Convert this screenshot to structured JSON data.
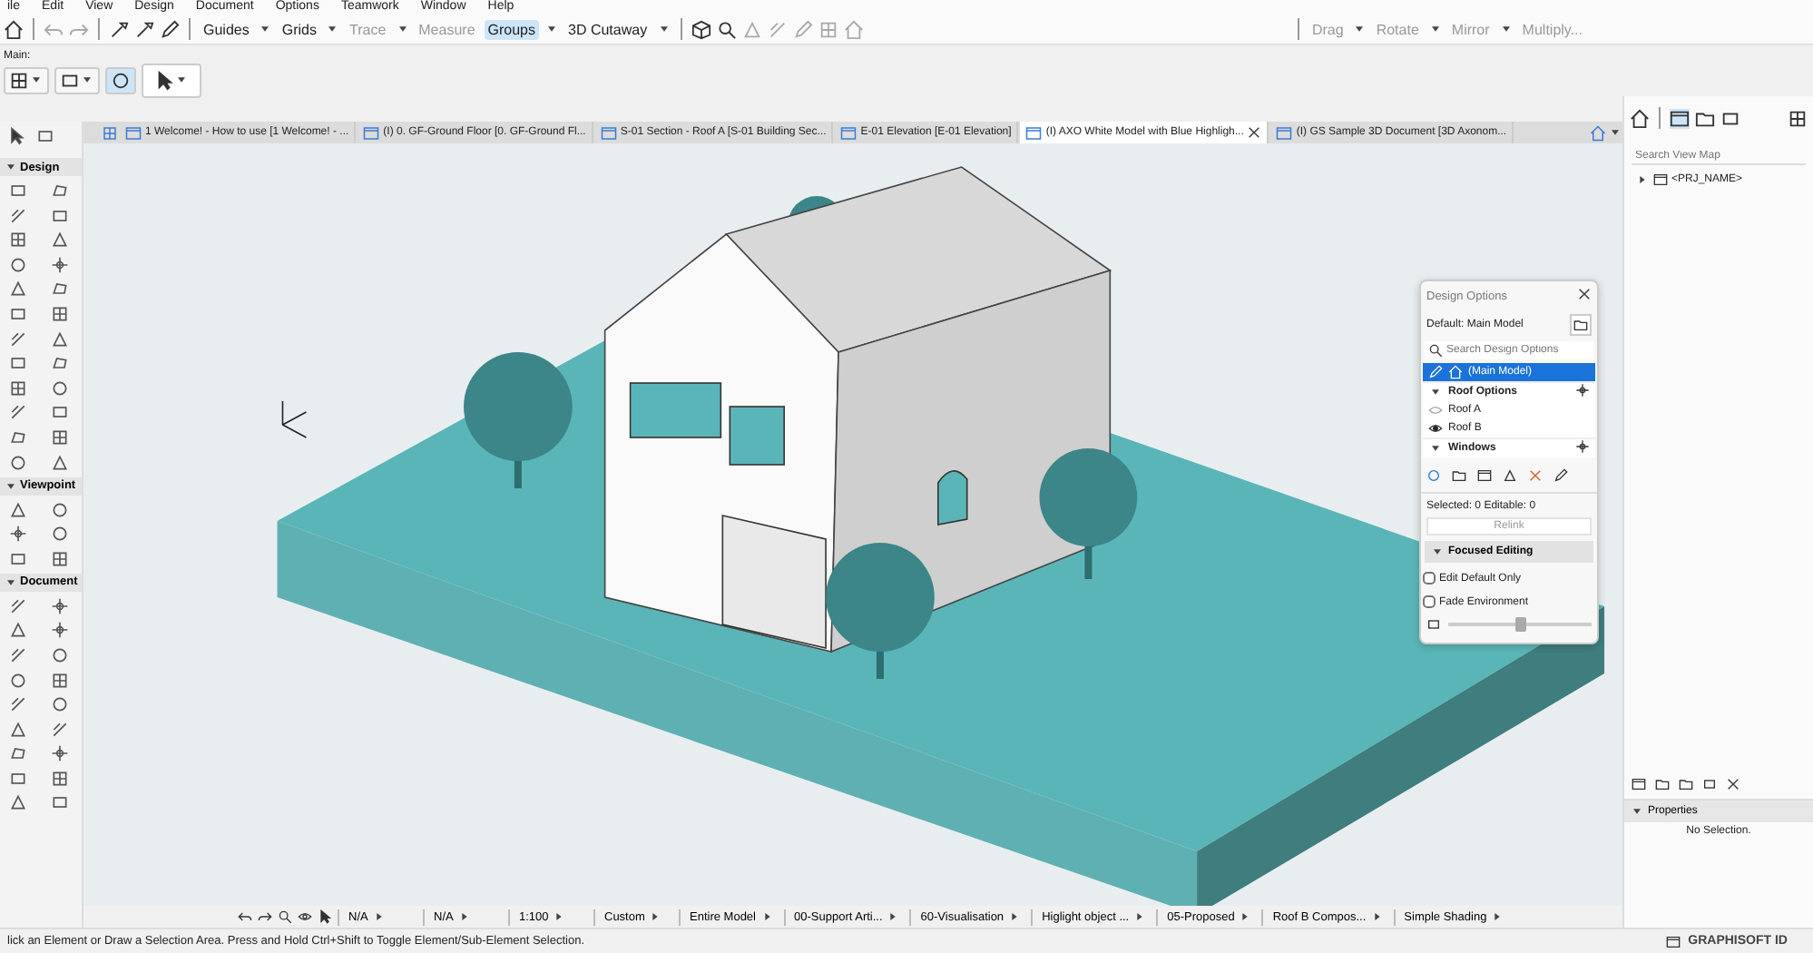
{
  "menu_bar": {
    "items": [
      "ile",
      "Edit",
      "View",
      "Design",
      "Document",
      "Options",
      "Teamwork",
      "Window",
      "Help"
    ]
  },
  "toolbar": {
    "tools": [
      {
        "label": "Guides",
        "kind": "dropdown",
        "disabled": false,
        "selected": false
      },
      {
        "label": "Grids",
        "kind": "dropdown",
        "disabled": false,
        "selected": false
      },
      {
        "label": "Trace",
        "kind": "dropdown",
        "disabled": true,
        "selected": false
      },
      {
        "label": "Measure",
        "kind": "button",
        "disabled": true,
        "selected": false
      },
      {
        "label": "Groups",
        "kind": "dropdown",
        "disabled": false,
        "selected": true
      },
      {
        "label": "3D Cutaway",
        "kind": "dropdown",
        "disabled": false,
        "selected": false
      }
    ],
    "edit_tools": [
      {
        "label": "Drag",
        "disabled": true
      },
      {
        "label": "Rotate",
        "disabled": true
      },
      {
        "label": "Mirror",
        "disabled": true
      },
      {
        "label": "Multiply...",
        "disabled": true
      }
    ]
  },
  "info_box": {
    "label": "Main:"
  },
  "tabs": [
    {
      "label": "1 Welcome! - How to use [1 Welcome! - ...",
      "selected": false,
      "closable": false
    },
    {
      "label": "(I) 0. GF-Ground Floor [0. GF-Ground Fl...",
      "selected": false,
      "closable": false
    },
    {
      "label": "S-01 Section - Roof A [S-01 Building Sec...",
      "selected": false,
      "closable": false
    },
    {
      "label": "E-01 Elevation [E-01 Elevation]",
      "selected": false,
      "closable": false
    },
    {
      "label": "(I) AXO White Model with Blue Highligh...",
      "selected": true,
      "closable": true
    },
    {
      "label": "(I) GS Sample 3D Document [3D Axonom...",
      "selected": false,
      "closable": false
    }
  ],
  "toolbox": {
    "sections": [
      {
        "title": "Design",
        "expanded": true
      },
      {
        "title": "Viewpoint",
        "expanded": true
      },
      {
        "title": "Document",
        "expanded": true
      }
    ]
  },
  "design_options": {
    "title": "Design Options",
    "default_label": "Default: Main Model",
    "search": {
      "placeholder": "Search Design Options"
    },
    "items": [
      {
        "label": "(Main Model)",
        "kind": "model",
        "selected": true
      },
      {
        "label": "Roof Options",
        "kind": "group",
        "selected": false
      },
      {
        "label": "Roof A",
        "kind": "option",
        "selected": false,
        "visible": false
      },
      {
        "label": "Roof B",
        "kind": "option",
        "selected": false,
        "visible": true
      },
      {
        "label": "Windows",
        "kind": "group",
        "selected": false
      }
    ],
    "selection_info": "Selected: 0 Editable: 0",
    "relink": {
      "label": "Relink",
      "disabled": true
    },
    "focused_editing": {
      "title": "Focused Editing",
      "expanded": true,
      "options": [
        {
          "label": "Edit Default Only",
          "checked": false
        },
        {
          "label": "Fade Environment",
          "checked": false
        }
      ],
      "slider": {
        "level": 0.5
      }
    }
  },
  "view_map": {
    "search": {
      "placeholder": "Search View Map"
    },
    "tree": [
      {
        "label": "<PRJ_NAME>",
        "expanded": false
      }
    ]
  },
  "properties": {
    "title": "Properties",
    "expanded": true,
    "message": "No Selection."
  },
  "navigator_bar": [
    {
      "value": "N/A"
    },
    {
      "value": "N/A"
    },
    {
      "value": "1:100"
    },
    {
      "value": "Custom"
    },
    {
      "value": "Entire Model"
    },
    {
      "value": "00-Support Arti..."
    },
    {
      "value": "60-Visualisation"
    },
    {
      "value": "Higlight object ..."
    },
    {
      "value": "05-Proposed"
    },
    {
      "value": "Roof B Compos..."
    },
    {
      "value": "Simple Shading"
    }
  ],
  "status_bar": {
    "message": "lick an Element or Draw a Selection Area. Press and Hold Ctrl+Shift to Toggle Element/Sub-Element Selection.",
    "account": "GRAPHISOFT ID"
  }
}
